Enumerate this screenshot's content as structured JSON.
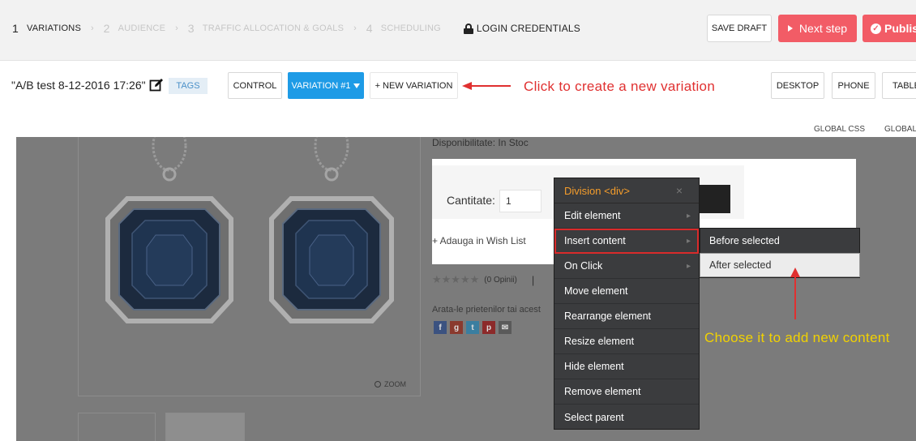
{
  "steps": [
    {
      "num": "1",
      "label": "VARIATIONS"
    },
    {
      "num": "2",
      "label": "AUDIENCE"
    },
    {
      "num": "3",
      "label": "TRAFFIC ALLOCATION & GOALS"
    },
    {
      "num": "4",
      "label": "SCHEDULING"
    }
  ],
  "login_label": "LOGIN CREDENTIALS",
  "toolbar": {
    "save_draft": "SAVE DRAFT",
    "next_step": "Next step",
    "publish": "Publish"
  },
  "test": {
    "name": "\"A/B test 8-12-2016 17:26\"",
    "tags": "TAGS"
  },
  "variations": {
    "control": "CONTROL",
    "variation1": "VARIATION #1",
    "new_variation": "+ NEW VARIATION"
  },
  "annotations": {
    "new_variation": "Click to create a new variation",
    "after_selected": "Choose it to add new content"
  },
  "devices": {
    "desktop": "DESKTOP",
    "phone": "PHONE",
    "tablet": "TABLE"
  },
  "global": {
    "css": "GLOBAL CSS",
    "js": "GLOBAL"
  },
  "product": {
    "availability": "Disponibilitate:  In Stoc",
    "quantity_label": "Cantitate:",
    "quantity_value": "1",
    "wishlist": "+ Adauga in Wish List",
    "reviews": "(0 Opinii)",
    "share_text": "Arata-le prietenilor tai acest",
    "zoom": "ZOOM"
  },
  "context_menu": {
    "title": "Division <div>",
    "close": "×",
    "items": [
      {
        "label": "Edit element",
        "submenu": true
      },
      {
        "label": "Insert content",
        "submenu": true
      },
      {
        "label": "On Click",
        "submenu": true
      },
      {
        "label": "Move element",
        "submenu": false
      },
      {
        "label": "Rearrange element",
        "submenu": false
      },
      {
        "label": "Resize element",
        "submenu": false
      },
      {
        "label": "Hide element",
        "submenu": false
      },
      {
        "label": "Remove element",
        "submenu": false
      },
      {
        "label": "Select parent",
        "submenu": false
      }
    ],
    "submenu": {
      "before": "Before selected",
      "after": "After selected"
    }
  },
  "colors": {
    "accent_red": "#f25c66",
    "variation_blue": "#1e9be6",
    "menu_bg": "#3b3c3e",
    "menu_title": "#f59d2b",
    "annotation_red": "#e03030",
    "annotation_yellow": "#f2d200"
  }
}
